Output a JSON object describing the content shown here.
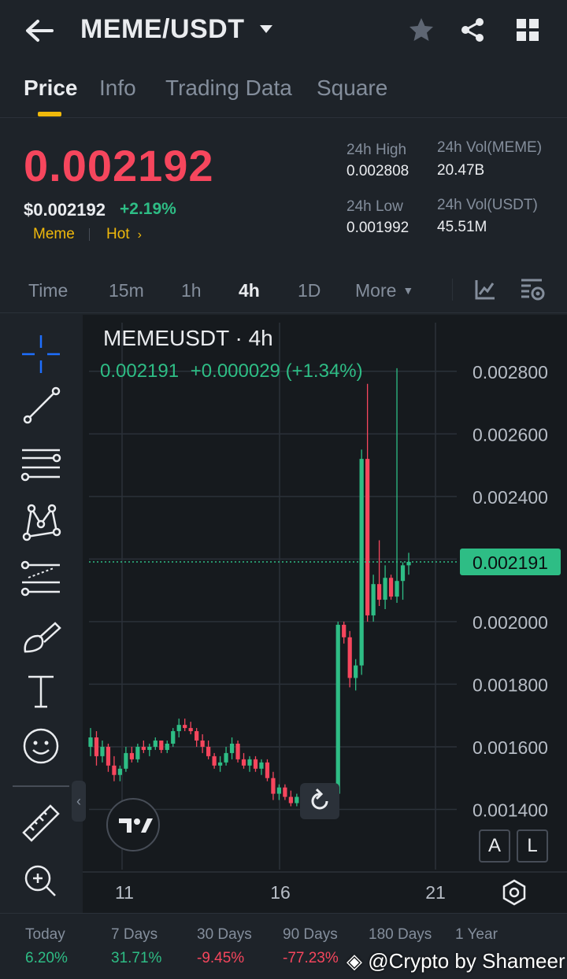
{
  "header": {
    "title": "MEME/USDT",
    "icons": [
      "back-arrow-icon",
      "caret-down-icon",
      "star-icon",
      "share-icon",
      "grid-icon"
    ]
  },
  "tabs": [
    {
      "label": "Price",
      "active": true
    },
    {
      "label": "Info",
      "active": false
    },
    {
      "label": "Trading Data",
      "active": false
    },
    {
      "label": "Square",
      "active": false
    }
  ],
  "ticker": {
    "last_price": "0.002192",
    "usd_price": "$0.002192",
    "change": "+2.19%",
    "tag1": "Meme",
    "tag2": "Hot",
    "high_label": "24h High",
    "high_value": "0.002808",
    "low_label": "24h Low",
    "low_value": "0.001992",
    "vol_base_label": "24h Vol(MEME)",
    "vol_base_value": "20.47B",
    "vol_quote_label": "24h Vol(USDT)",
    "vol_quote_value": "45.51M"
  },
  "intervals": [
    {
      "label": "Time",
      "active": false
    },
    {
      "label": "15m",
      "active": false
    },
    {
      "label": "1h",
      "active": false
    },
    {
      "label": "4h",
      "active": true
    },
    {
      "label": "1D",
      "active": false
    },
    {
      "label": "More",
      "active": false
    }
  ],
  "chart": {
    "symbol": "MEMEUSDT · 4h",
    "ohlc_close": "0.002191",
    "ohlc_change": "+0.000029 (+1.34%)",
    "current_price_label": "0.002191",
    "axis_btn_a": "A",
    "axis_btn_l": "L",
    "collapse": "‹",
    "colors": {
      "up": "#2ebd85",
      "down": "#f6465d",
      "bg": "#161a1e",
      "grid": "#2b3139"
    }
  },
  "chart_data": {
    "type": "candlestick",
    "y_ticks": [
      "0.002800",
      "0.002600",
      "0.002400",
      "0.002200",
      "0.002000",
      "0.001800",
      "0.001600",
      "0.001400"
    ],
    "ylim": [
      0.0012,
      0.00288
    ],
    "x_ticks": [
      "11",
      "16",
      "21"
    ],
    "current_price": 0.002191,
    "candles": [
      [
        0.0016,
        0.00166,
        0.00157,
        0.00163
      ],
      [
        0.00163,
        0.00165,
        0.00154,
        0.00157
      ],
      [
        0.00157,
        0.00162,
        0.00155,
        0.0016
      ],
      [
        0.0016,
        0.00161,
        0.00152,
        0.00154
      ],
      [
        0.00154,
        0.00157,
        0.00149,
        0.00151
      ],
      [
        0.00151,
        0.00154,
        0.00149,
        0.00153
      ],
      [
        0.00153,
        0.0016,
        0.00152,
        0.00158
      ],
      [
        0.00158,
        0.0016,
        0.00155,
        0.00156
      ],
      [
        0.00156,
        0.00161,
        0.00155,
        0.0016
      ],
      [
        0.0016,
        0.00162,
        0.00158,
        0.00159
      ],
      [
        0.00159,
        0.00161,
        0.00157,
        0.0016
      ],
      [
        0.0016,
        0.00163,
        0.00159,
        0.00162
      ],
      [
        0.00162,
        0.00162,
        0.00158,
        0.00159
      ],
      [
        0.00159,
        0.00162,
        0.00158,
        0.00161
      ],
      [
        0.00161,
        0.00166,
        0.0016,
        0.00165
      ],
      [
        0.00165,
        0.00169,
        0.00163,
        0.00167
      ],
      [
        0.00167,
        0.00169,
        0.00165,
        0.00166
      ],
      [
        0.00166,
        0.00168,
        0.00164,
        0.00165
      ],
      [
        0.00165,
        0.00166,
        0.0016,
        0.00162
      ],
      [
        0.00162,
        0.00164,
        0.00158,
        0.0016
      ],
      [
        0.0016,
        0.00162,
        0.00156,
        0.00157
      ],
      [
        0.00157,
        0.00158,
        0.00153,
        0.00154
      ],
      [
        0.00154,
        0.00157,
        0.00152,
        0.00155
      ],
      [
        0.00155,
        0.0016,
        0.00154,
        0.00158
      ],
      [
        0.00158,
        0.00163,
        0.00156,
        0.00161
      ],
      [
        0.00161,
        0.00162,
        0.00155,
        0.00156
      ],
      [
        0.00156,
        0.00158,
        0.00153,
        0.00154
      ],
      [
        0.00154,
        0.00157,
        0.00152,
        0.00156
      ],
      [
        0.00156,
        0.00157,
        0.00152,
        0.00153
      ],
      [
        0.00153,
        0.00156,
        0.00151,
        0.00155
      ],
      [
        0.00155,
        0.00156,
        0.00149,
        0.0015
      ],
      [
        0.0015,
        0.00152,
        0.00143,
        0.00145
      ],
      [
        0.00145,
        0.00148,
        0.00143,
        0.00147
      ],
      [
        0.00147,
        0.00148,
        0.00143,
        0.00144
      ],
      [
        0.00144,
        0.00146,
        0.00141,
        0.00142
      ],
      [
        0.00142,
        0.00145,
        0.00141,
        0.00144
      ],
      [
        0.00144,
        0.00146,
        0.00141,
        0.00142
      ],
      [
        0.00142,
        0.00144,
        0.00141,
        0.00143
      ],
      [
        0.00143,
        0.00145,
        0.00141,
        0.00142
      ],
      [
        0.00142,
        0.00144,
        0.0014,
        0.00143
      ],
      [
        0.00143,
        0.00145,
        0.00141,
        0.00142
      ],
      [
        0.00142,
        0.00146,
        0.00141,
        0.00145
      ],
      [
        0.00145,
        0.002,
        0.00144,
        0.00199
      ],
      [
        0.00199,
        0.002,
        0.00193,
        0.00195
      ],
      [
        0.00195,
        0.00197,
        0.00179,
        0.00182
      ],
      [
        0.00182,
        0.00188,
        0.00178,
        0.00186
      ],
      [
        0.00186,
        0.00255,
        0.00183,
        0.00252
      ],
      [
        0.00252,
        0.00276,
        0.002,
        0.00202
      ],
      [
        0.00202,
        0.00215,
        0.002,
        0.00212
      ],
      [
        0.00212,
        0.00226,
        0.00205,
        0.00207
      ],
      [
        0.00207,
        0.00218,
        0.00204,
        0.00214
      ],
      [
        0.00214,
        0.00215,
        0.00207,
        0.00208
      ],
      [
        0.00208,
        0.00281,
        0.00206,
        0.00213
      ],
      [
        0.00213,
        0.00219,
        0.00207,
        0.00218
      ],
      [
        0.00218,
        0.00222,
        0.00215,
        0.002191
      ]
    ]
  },
  "footer": {
    "periods": [
      {
        "label": "Today",
        "value": "6.20%",
        "dir": "up"
      },
      {
        "label": "7 Days",
        "value": "31.71%",
        "dir": "up"
      },
      {
        "label": "30 Days",
        "value": "-9.45%",
        "dir": "down"
      },
      {
        "label": "90 Days",
        "value": "-77.23%",
        "dir": "down"
      },
      {
        "label": "180 Days",
        "value": "",
        "dir": "down"
      },
      {
        "label": "1 Year",
        "value": "",
        "dir": "down"
      }
    ],
    "watermark": "@Crypto by Shameer"
  }
}
